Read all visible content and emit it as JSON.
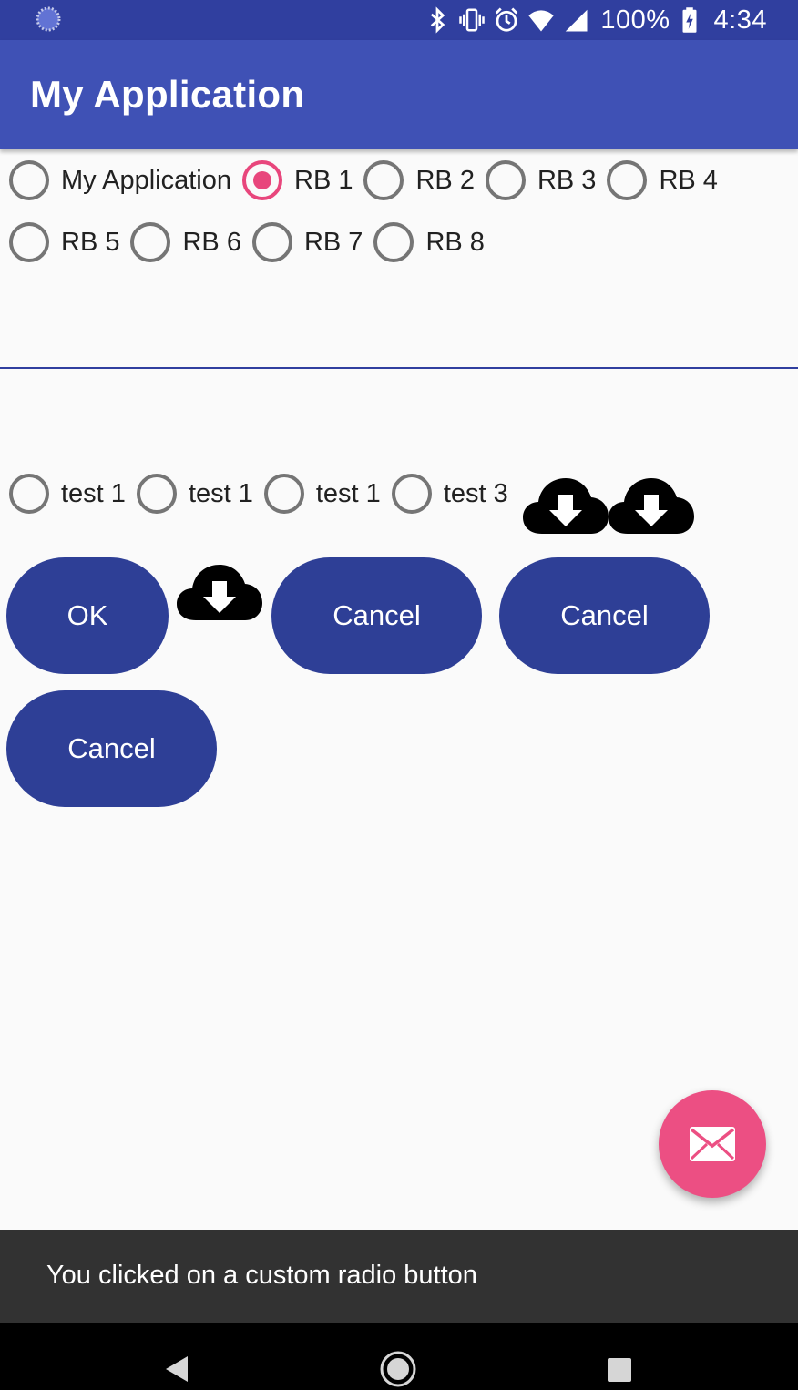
{
  "status_bar": {
    "battery": "100%",
    "time": "4:34",
    "icons": [
      "loading-icon",
      "bluetooth-icon",
      "vibrate-icon",
      "alarm-icon",
      "wifi-icon",
      "signal-icon",
      "battery-charging-icon"
    ]
  },
  "app_bar": {
    "title": "My Application"
  },
  "radio_group_1": {
    "row1": [
      {
        "label": "My Application",
        "checked": false
      },
      {
        "label": "RB 1",
        "checked": true
      },
      {
        "label": "RB 2",
        "checked": false
      },
      {
        "label": "RB 3",
        "checked": false
      },
      {
        "label": "RB 4",
        "checked": false
      }
    ],
    "row2": [
      {
        "label": "RB 5",
        "checked": false
      },
      {
        "label": "RB 6",
        "checked": false
      },
      {
        "label": "RB 7",
        "checked": false
      },
      {
        "label": "RB 8",
        "checked": false
      }
    ]
  },
  "radio_group_2": [
    {
      "label": "test 1",
      "checked": false
    },
    {
      "label": "test 1",
      "checked": false
    },
    {
      "label": "test 1",
      "checked": false
    },
    {
      "label": "test 3",
      "checked": false
    }
  ],
  "buttons": {
    "ok": "OK",
    "cancel_1": "Cancel",
    "cancel_2": "Cancel",
    "cancel_3": "Cancel"
  },
  "fab": {
    "icon": "mail-icon"
  },
  "snackbar": {
    "message": "You clicked on a custom radio button"
  },
  "nav_bar": {
    "icons": [
      "back-icon",
      "home-icon",
      "recents-icon"
    ]
  },
  "colors": {
    "primary": "#3f51b5",
    "primary_dark": "#303f9f",
    "button": "#2e3f96",
    "accent": "#e8467c",
    "snackbar": "#323232"
  }
}
